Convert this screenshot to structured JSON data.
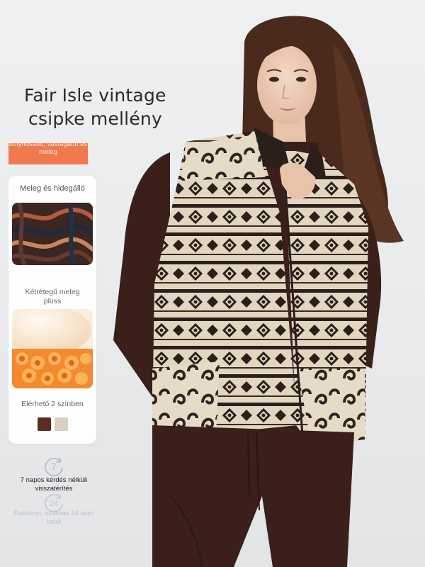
{
  "headline": {
    "line1": "Fair Isle vintage",
    "line2": "csipke mellény"
  },
  "badge": {
    "text": "bolyhosabb, vastagabb és meleg",
    "color": "#f07a4e"
  },
  "feature_card": {
    "title": "Meleg és hidegálló",
    "feature1_caption": "Kétrétegű meleg plüss",
    "feature2_caption": "Elérhető 2 színben",
    "colors": [
      "#5b2e22",
      "#d8d0c0"
    ]
  },
  "services": [
    {
      "icon": "return-7-days-icon",
      "number": "7",
      "text": "7 napos kérdés nélküli visszatérítés"
    },
    {
      "icon": "delivery-24h-icon",
      "number": "24",
      "text": "Raktáron, szállítás 24 órán belül"
    }
  ]
}
